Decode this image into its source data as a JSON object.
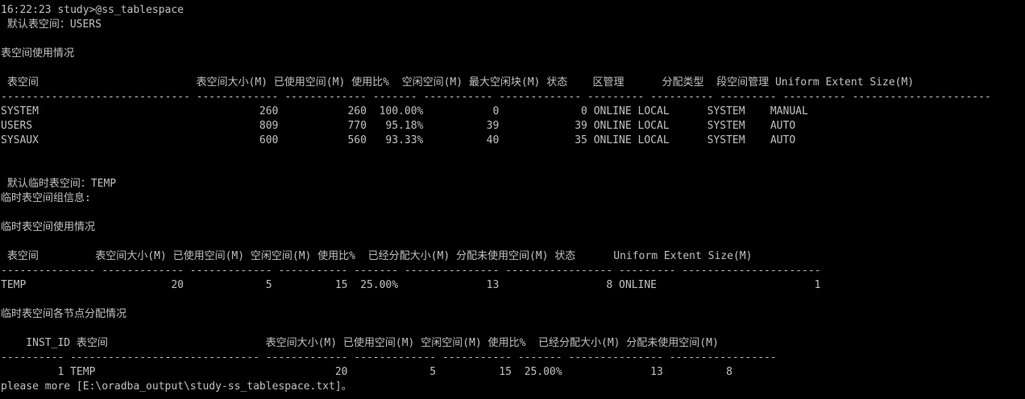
{
  "terminal": {
    "colors": {
      "background": "#000000",
      "text": "#c0c0c0"
    },
    "prompt": "16:22:23 study>@ss_tablespace",
    "default_tablespace": " 默认表空间：USERS",
    "usage_section": {
      "title": "表空间使用情况",
      "header": " 表空间                         表空间大小(M) 已使用空间(M) 使用比%  空闲空间(M) 最大空闲块(M) 状态    区管理      分配类型  段空间管理 Uniform Extent Size(M)",
      "separator": "------------------------------ ------------- ------------- ------- ----------- ------------- --------- ---------- --------- ---------- ----------------------",
      "rows": [
        "SYSTEM                                   260           260  100.00%           0             0 ONLINE LOCAL      SYSTEM    MANUAL",
        "USERS                                    809           770   95.18%          39            39 ONLINE LOCAL      SYSTEM    AUTO",
        "SYSAUX                                   600           560   93.33%          40            35 ONLINE LOCAL      SYSTEM    AUTO"
      ]
    },
    "default_temp_tablespace": " 默认临时表空间：TEMP",
    "temp_group_info": "临时表空间组信息:",
    "temp_usage_section": {
      "title": "临时表空间使用情况",
      "header": " 表空间         表空间大小(M) 已使用空间(M) 空闲空间(M) 使用比%  已经分配大小(M) 分配未使用空间(M) 状态      Uniform Extent Size(M)",
      "separator": "--------------- ------------- ------------- ----------- ------- --------------- ----------------- --------- ----------------------",
      "rows": [
        "TEMP                       20             5          15  25.00%              13                 8 ONLINE                         1"
      ]
    },
    "temp_nodes_section": {
      "title": "临时表空间各节点分配情况",
      "header": "    INST_ID 表空间                         表空间大小(M) 已使用空间(M) 空闲空间(M) 使用比%  已经分配大小(M) 分配未使用空间(M)",
      "separator": "---------- ------------------------------ ------------- ------------- ----------- ------- --------------- -----------------",
      "rows": [
        "         1 TEMP                                      20             5          15  25.00%              13          8"
      ]
    },
    "footer": "please more [E:\\oradba_output\\study-ss_tablespace.txt]。"
  }
}
